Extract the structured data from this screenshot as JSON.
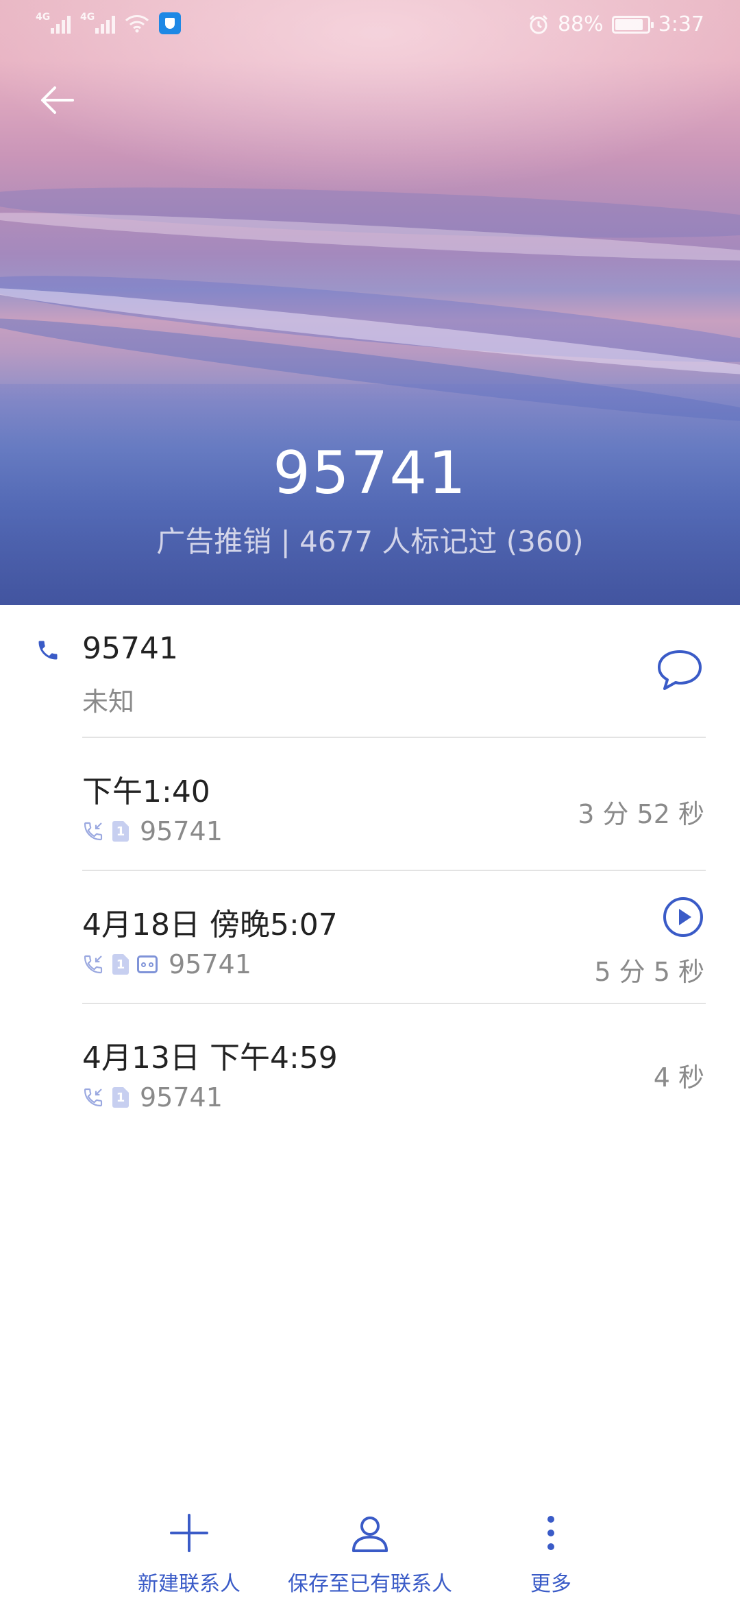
{
  "status_bar": {
    "signal1_tag": "4G",
    "signal2_tag": "4G",
    "battery_percent": "88%",
    "battery_level": 0.88,
    "time": "3:37"
  },
  "header": {
    "number": "95741",
    "subtitle": "广告推销 | 4677 人标记过 (360)"
  },
  "contact": {
    "number": "95741",
    "location": "未知"
  },
  "calls": [
    {
      "time": "下午1:40",
      "number": "95741",
      "duration": "3 分 52 秒",
      "voicemail": false
    },
    {
      "time": "4月18日 傍晚5:07",
      "number": "95741",
      "duration": "5 分 5 秒",
      "voicemail": true
    },
    {
      "time": "4月13日 下午4:59",
      "number": "95741",
      "duration": "4 秒",
      "voicemail": false
    }
  ],
  "sim_label": "1",
  "toolbar": {
    "new_contact": "新建联系人",
    "save_existing": "保存至已有联系人",
    "more": "更多"
  },
  "colors": {
    "accent": "#3a5bc7",
    "secondary_text": "#8a8a8a",
    "divider": "#e3e3e3"
  }
}
